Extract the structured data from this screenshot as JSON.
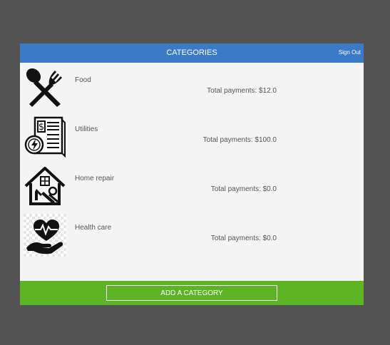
{
  "header": {
    "title": "CATEGORIES",
    "sign_out": "Sign Out",
    "color": "#3b7ac7"
  },
  "categories": [
    {
      "name": "Food",
      "total": "Total payments: $12.0",
      "icon": "fork-spoon-icon"
    },
    {
      "name": "Utilities",
      "total": "Total payments: $100.0",
      "icon": "utility-bill-icon"
    },
    {
      "name": "Home repair",
      "total": "Total payments: $0.0",
      "icon": "house-repair-icon"
    },
    {
      "name": "Health care",
      "total": "Total payments: $0.0",
      "icon": "heart-hand-icon"
    }
  ],
  "footer": {
    "add_label": "ADD A CATEGORY",
    "color": "#5db525"
  }
}
